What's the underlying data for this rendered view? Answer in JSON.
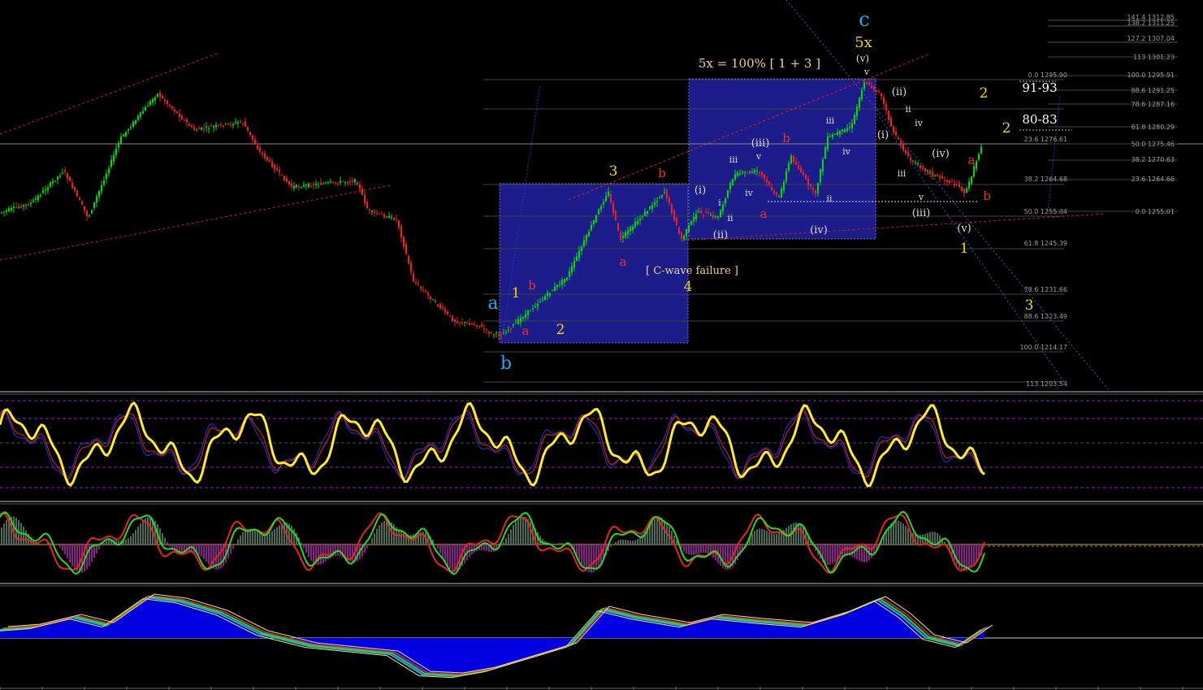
{
  "chart_data": {
    "type": "candlestick",
    "colors": {
      "up": "#00dd00",
      "down": "#ee2222",
      "background": "#000000"
    },
    "fib_levels": [
      {
        "text": "141.4 1312.85"
      },
      {
        "text": "138.2 1311.25"
      },
      {
        "text": "127.2 1307.04"
      },
      {
        "text": "113 1301.23"
      },
      {
        "text": "100.0 1295.91"
      },
      {
        "text": "88.6 1291.25"
      },
      {
        "text": "78.6 1287.16"
      },
      {
        "text": "61.8 1280.29"
      },
      {
        "text": "50.0 1275.46"
      },
      {
        "text": "38.2 1270.63"
      },
      {
        "text": "23.6 1264.66"
      },
      {
        "text": "0.0 1255.01"
      },
      {
        "text": "0.0 1295.90"
      },
      {
        "text": "23.6 1276.61"
      },
      {
        "text": "38.2 1264.68"
      },
      {
        "text": "50.0 1255.04"
      },
      {
        "text": "61.8 1245.39"
      },
      {
        "text": "78.6 1231.66"
      },
      {
        "text": "88.6 1223.49"
      },
      {
        "text": "100.0 1214.17"
      },
      {
        "text": "113 1203.54"
      }
    ],
    "annotations": {
      "c_top": "c",
      "fivex": "5x",
      "fivex_formula": "5x = 100% [ 1 + 3 ]",
      "c_wave_failure": "[ C-wave failure ]",
      "target_91_93": "91-93",
      "target_80_83": "80-83",
      "wave_a": "a",
      "wave_b": "b",
      "wave_v_paren": "(v)",
      "wave_v": "v",
      "wave_ii_paren": "(ii)",
      "wave_i_paren": "(i)",
      "wave_ii": "ii",
      "wave_iii": "iii",
      "wave_iv": "iv",
      "wave_iv_paren": "(iv)",
      "wave_iii_paren": "(iii)",
      "wave_i": "i",
      "num1": "1",
      "num2": "2",
      "num3": "3",
      "num4": "4"
    }
  }
}
